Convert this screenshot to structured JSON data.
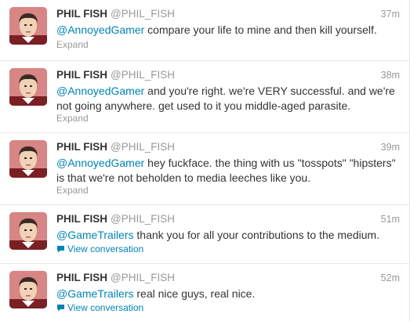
{
  "tweets": [
    {
      "fullname": "PHIL FISH",
      "username": "@PHIL_FISH",
      "time": "37m",
      "mention": "@AnnoyedGamer",
      "text": " compare your life to mine and then kill yourself.",
      "action": "Expand"
    },
    {
      "fullname": "PHIL FISH",
      "username": "@PHIL_FISH",
      "time": "38m",
      "mention": "@AnnoyedGamer",
      "text": " and you're right. we're VERY successful. and we're not going anywhere. get used to it you middle-aged parasite.",
      "action": "Expand"
    },
    {
      "fullname": "PHIL FISH",
      "username": "@PHIL_FISH",
      "time": "39m",
      "mention": "@AnnoyedGamer",
      "text": " hey fuckface. the thing with us \"tosspots\" \"hipsters\" is that we're not beholden to media leeches like you.",
      "action": "Expand"
    },
    {
      "fullname": "PHIL FISH",
      "username": "@PHIL_FISH",
      "time": "51m",
      "mention": "@GameTrailers",
      "text": " thank you for all your contributions to the medium.",
      "action": "View conversation"
    },
    {
      "fullname": "PHIL FISH",
      "username": "@PHIL_FISH",
      "time": "52m",
      "mention": "@GameTrailers",
      "text": " real nice guys, real nice.",
      "action": "View conversation"
    }
  ],
  "colors": {
    "link": "#0084b4",
    "muted": "#999999",
    "text": "#333333"
  },
  "icons": {
    "avatar": "profile-avatar",
    "conversation": "speech-bubble-icon"
  }
}
